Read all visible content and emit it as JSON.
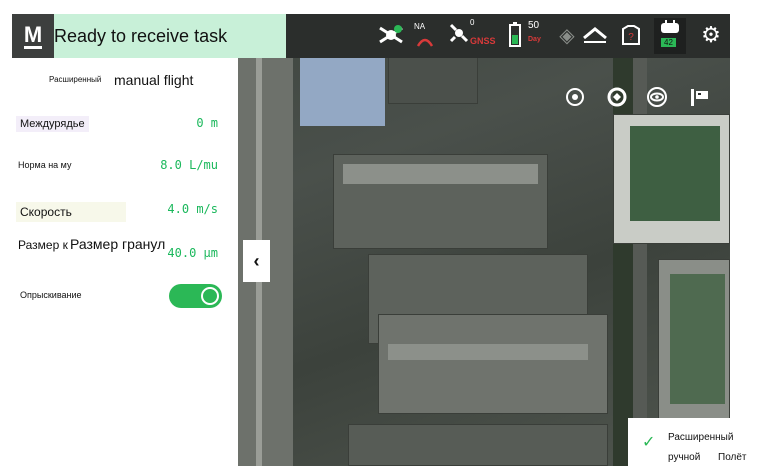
{
  "header": {
    "logo_text": "M",
    "status_text": "Ready to receive task",
    "na_label": "NA",
    "gnss_count": "0",
    "gnss_label": "GNSS",
    "battery_value": "50",
    "battery_unit": "Day",
    "controller_badge": "42"
  },
  "panel": {
    "title_prefix": "Расширенный",
    "title_main": "manual flight",
    "row_spacing_label": "Междурядье",
    "row_spacing_value": "0 m",
    "rate_label": "Норма на му",
    "rate_value": "8.0 L/mu",
    "speed_label": "Скорость",
    "speed_value": "4.0 m/s",
    "granule_label_a": "Размер к",
    "granule_label_b": "Размер гранул",
    "granule_value": "40.0 μm",
    "spraying_label": "Опрыскивание",
    "spraying_on": true
  },
  "mode_badge": {
    "line1": "Расширенный",
    "line2": "ручной",
    "line3": "Полёт"
  },
  "colors": {
    "status_bg": "#c8f0d8",
    "accent_green": "#1bb85c",
    "topbar_bg": "#2b2e2c"
  },
  "icons": [
    "drone-status-icon",
    "signal-icon",
    "gnss-icon",
    "battery-icon",
    "altitude-icon",
    "pump-icon",
    "controller-icon",
    "gear-icon",
    "target-icon",
    "locate-icon",
    "eye-icon",
    "map-layer-icon",
    "chevron-left-icon",
    "check-icon"
  ]
}
